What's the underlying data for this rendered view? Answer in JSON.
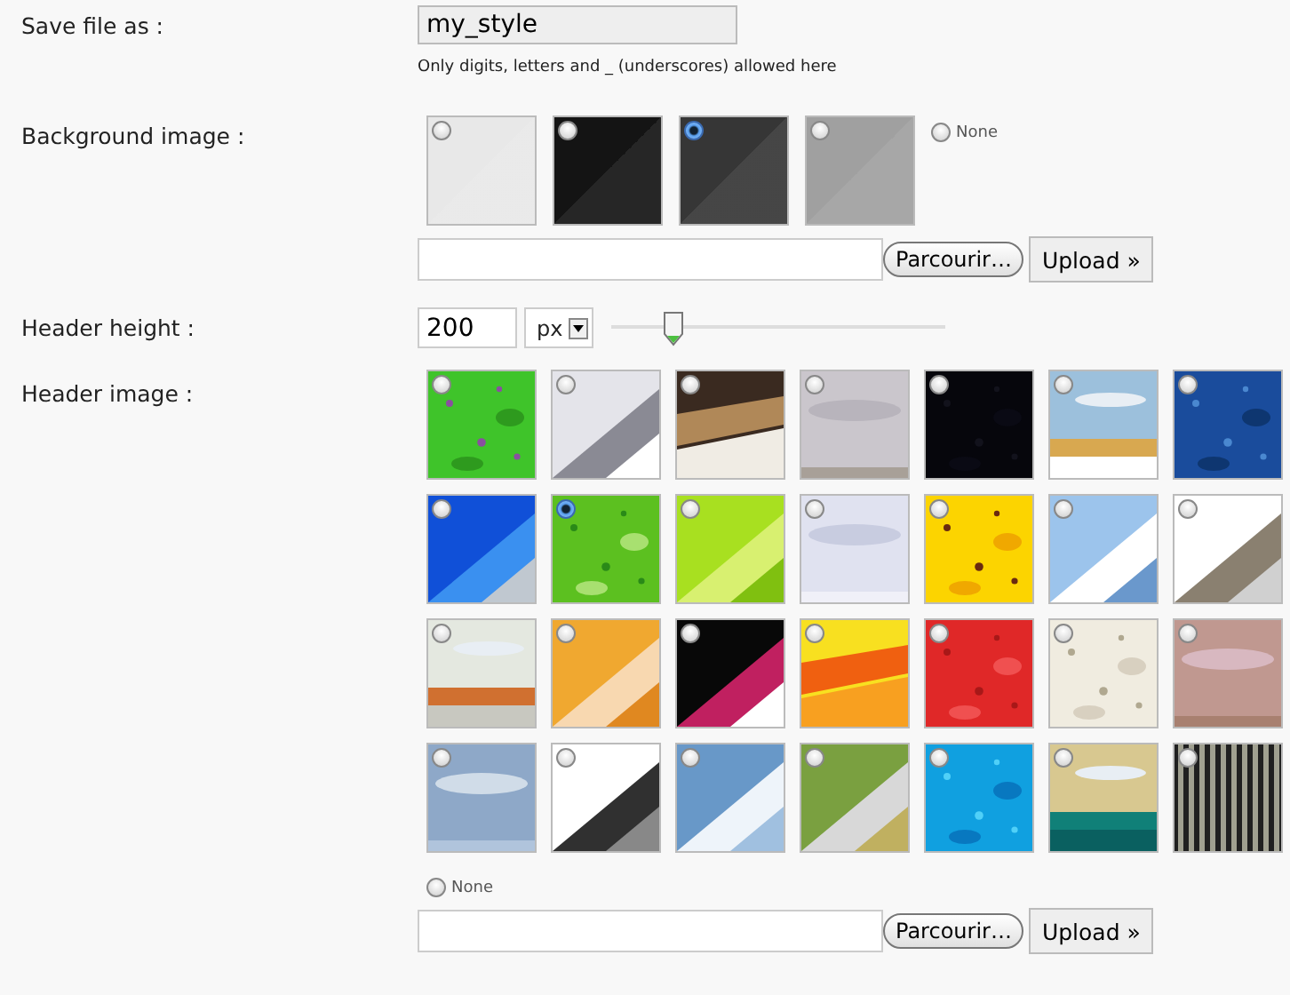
{
  "save_file": {
    "label": "Save file as :",
    "value": "my_style",
    "hint": "Only digits, letters and _ (underscores) allowed here"
  },
  "background_image": {
    "label": "Background image :",
    "options": [
      {
        "color": "#e8e8e8",
        "selected": false
      },
      {
        "color": "#141414",
        "selected": false
      },
      {
        "color": "#363636",
        "selected": true
      },
      {
        "color": "#a0a0a0",
        "selected": false
      }
    ],
    "none": {
      "label": "None",
      "selected": false
    },
    "browse_button": "Parcourir…",
    "upload_button": "Upload »"
  },
  "header_height": {
    "label": "Header height :",
    "value": "200",
    "unit": "px",
    "level": 0.19
  },
  "header_image": {
    "label": "Header image :",
    "options": [
      {
        "kind": "picture",
        "selected": false
      },
      {
        "kind": "picture",
        "selected": false
      },
      {
        "kind": "picture",
        "selected": false
      },
      {
        "kind": "picture",
        "selected": false
      },
      {
        "kind": "picture",
        "selected": false
      },
      {
        "kind": "picture",
        "selected": false
      },
      {
        "kind": "picture",
        "selected": false
      },
      {
        "kind": "picture",
        "selected": false
      },
      {
        "kind": "picture",
        "selected": true
      },
      {
        "kind": "picture",
        "selected": false
      },
      {
        "kind": "picture",
        "selected": false
      },
      {
        "kind": "picture",
        "selected": false
      },
      {
        "kind": "picture",
        "selected": false
      },
      {
        "kind": "picture",
        "selected": false
      },
      {
        "kind": "picture",
        "selected": false
      },
      {
        "kind": "picture",
        "selected": false
      },
      {
        "kind": "picture",
        "selected": false
      },
      {
        "kind": "picture",
        "selected": false
      },
      {
        "kind": "picture",
        "selected": false
      },
      {
        "kind": "picture",
        "selected": false
      },
      {
        "kind": "picture",
        "selected": false
      },
      {
        "kind": "picture",
        "selected": false
      },
      {
        "kind": "picture",
        "selected": false
      },
      {
        "kind": "picture",
        "selected": false
      },
      {
        "kind": "picture",
        "selected": false
      },
      {
        "kind": "picture",
        "selected": false
      },
      {
        "kind": "picture",
        "selected": false
      },
      {
        "kind": "picture",
        "selected": false
      }
    ],
    "none": {
      "label": "None",
      "selected": false
    },
    "browse_button": "Parcourir…",
    "upload_button": "Upload »"
  }
}
